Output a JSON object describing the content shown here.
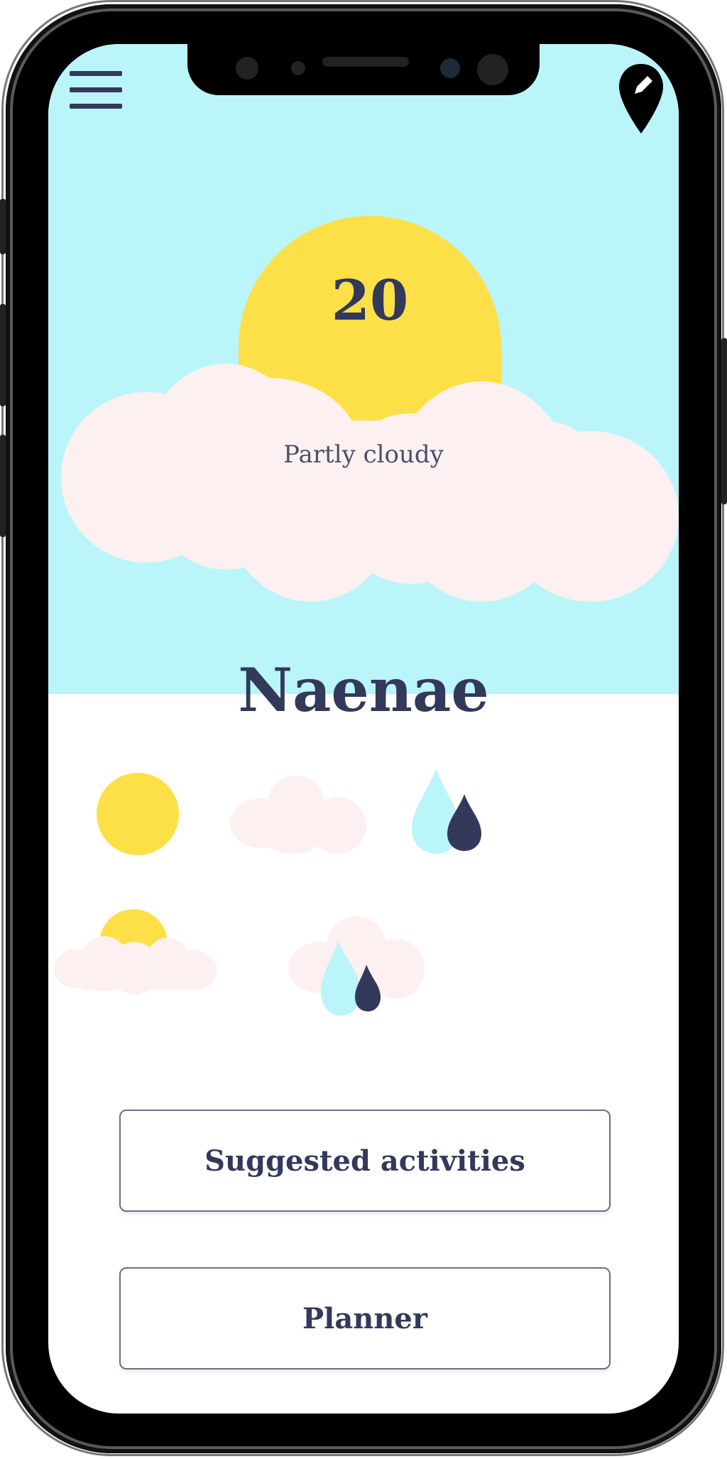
{
  "header": {
    "menu_icon": "hamburger-menu-icon",
    "edit_location_icon": "map-pin-pencil-icon"
  },
  "weather": {
    "temperature": "20",
    "condition": "Partly cloudy",
    "location": "Naenae"
  },
  "weather_types": [
    {
      "name": "sun-icon"
    },
    {
      "name": "cloud-icon"
    },
    {
      "name": "rain-drops-icon"
    },
    {
      "name": "sun-cloud-icon"
    },
    {
      "name": "cloud-rain-icon"
    }
  ],
  "actions": {
    "suggested_label": "Suggested activities",
    "planner_label": "Planner"
  },
  "colors": {
    "sky": "#baf5fa",
    "sun": "#fde047",
    "cloud": "#fdf0f0",
    "drop_light": "#baf5fa",
    "drop_dark": "#33395a",
    "text": "#33395a"
  }
}
